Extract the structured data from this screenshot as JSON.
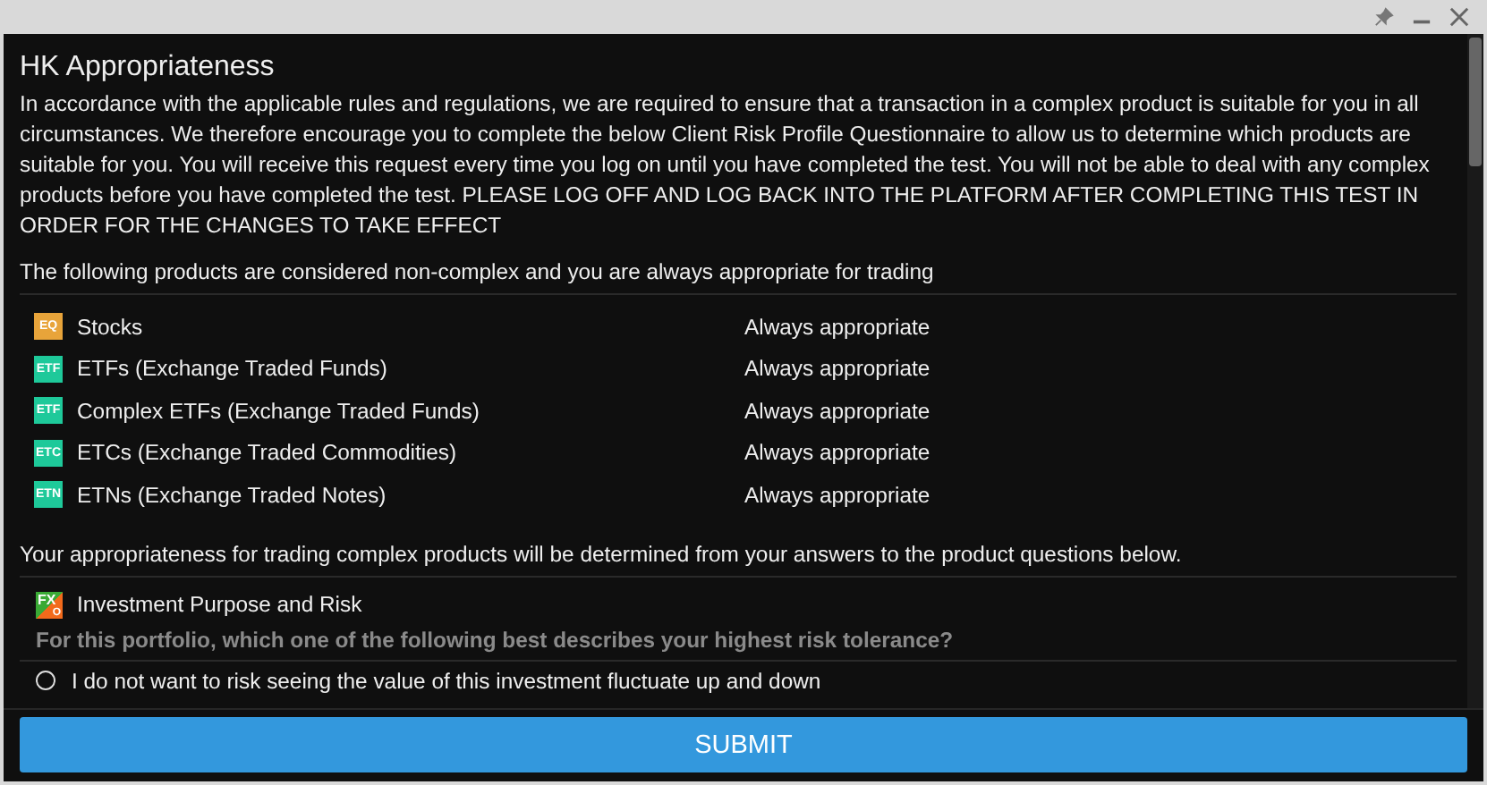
{
  "window": {
    "title": "HK Appropriateness"
  },
  "intro": "In accordance with the applicable rules and regulations, we are required to ensure that a transaction in a complex product is suitable for you in all circumstances. We therefore encourage you to complete the below Client Risk Profile Questionnaire to allow us to determine which products are suitable for you. You will receive this request every time you log on until you have completed the test. You will not be able to deal with any complex products before you have completed the test. PLEASE LOG OFF AND LOG BACK INTO THE PLATFORM AFTER COMPLETING THIS TEST IN ORDER FOR THE CHANGES TO TAKE EFFECT",
  "non_complex_heading": "The following products are considered non-complex and you are always appropriate for trading",
  "products": [
    {
      "badge": "EQ",
      "color": "#e8a43a",
      "name": "Stocks",
      "status": "Always appropriate"
    },
    {
      "badge": "ETF",
      "color": "#1ec99a",
      "name": "ETFs (Exchange Traded Funds)",
      "status": "Always appropriate"
    },
    {
      "badge": "ETF",
      "color": "#1ec99a",
      "name": "Complex ETFs (Exchange Traded Funds)",
      "status": "Always appropriate"
    },
    {
      "badge": "ETC",
      "color": "#1ec99a",
      "name": "ETCs (Exchange Traded Commodities)",
      "status": "Always appropriate"
    },
    {
      "badge": "ETN",
      "color": "#1ec99a",
      "name": "ETNs (Exchange Traded Notes)",
      "status": "Always appropriate"
    }
  ],
  "complex_heading": "Your appropriateness for trading complex products will be determined from your answers to the product questions below.",
  "section": {
    "badge": "FX",
    "badge_sub": "O",
    "title": "Investment Purpose and Risk",
    "question": "For this portfolio, which one of the following best describes your highest risk tolerance?",
    "options": [
      {
        "label": "I do not want to risk seeing the value of this investment fluctuate up and down",
        "selected": false
      }
    ]
  },
  "submit": "SUBMIT"
}
